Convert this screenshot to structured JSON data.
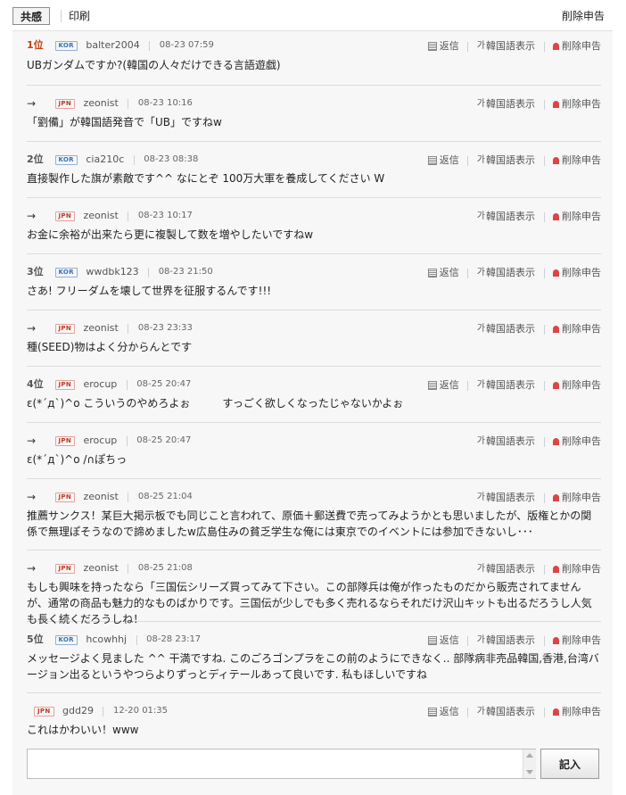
{
  "toolbar": {
    "empathy": "共感",
    "print": "印刷",
    "report": "削除申告"
  },
  "labels": {
    "reply": "返信",
    "korean": "韓国語表示",
    "korean_prefix": "가",
    "report": "削除申告",
    "arrow": "→"
  },
  "comments": [
    {
      "rank": "1位",
      "country": "KOR",
      "user": "balter2004",
      "date": "08-23 07:59",
      "text": "UBガンダムですか?(韓国の人々だけできる言語遊戯)"
    },
    {
      "rank": "",
      "country": "JPN",
      "user": "zeonist",
      "date": "08-23 10:16",
      "text": "「劉備」が韓国語発音で「UB」ですねw"
    },
    {
      "rank": "2位",
      "country": "KOR",
      "user": "cia210c",
      "date": "08-23 08:38",
      "text": "直接製作した旗が素敵です^^ なにとぞ 100万大軍を養成してください W"
    },
    {
      "rank": "",
      "country": "JPN",
      "user": "zeonist",
      "date": "08-23 10:17",
      "text": "お金に余裕が出来たら更に複製して数を増やしたいですねw"
    },
    {
      "rank": "3位",
      "country": "KOR",
      "user": "wwdbk123",
      "date": "08-23 21:50",
      "text": "さあ! フリーダムを壊して世界を征服するんです!!!"
    },
    {
      "rank": "",
      "country": "JPN",
      "user": "zeonist",
      "date": "08-23 23:33",
      "text": "種(SEED)物はよく分からんとです"
    },
    {
      "rank": "4位",
      "country": "JPN",
      "user": "erocup",
      "date": "08-25 20:47",
      "text": "ε(*´д`)^o こういうのやめろよぉ　　　すっごく欲しくなったじゃないかよぉ"
    },
    {
      "rank": "",
      "country": "JPN",
      "user": "erocup",
      "date": "08-25 20:47",
      "text": "ε(*´д`)^o /∩ぽちっ"
    },
    {
      "rank": "",
      "country": "JPN",
      "user": "zeonist",
      "date": "08-25 21:04",
      "text": "推薦サンクス！某巨大掲示板でも同じこと言われて、原価＋郵送費で売ってみようかとも思いましたが、版権とかの関係で無理ぽそうなので諦めましたw広島住みの貧乏学生な俺には東京でのイベントには参加できないし･･･"
    },
    {
      "rank": "",
      "country": "JPN",
      "user": "zeonist",
      "date": "08-25 21:08",
      "text": "もしも興味を持ったなら「三国伝シリーズ買ってみて下さい。この部隊兵は俺が作ったものだから販売されてませんが、通常の商品も魅力的なものばかりです。三国伝が少しでも多く売れるならそれだけ沢山キットも出るだろうし人気も長く続くだろうしね！"
    },
    {
      "rank": "5位",
      "country": "KOR",
      "user": "hcowhhj",
      "date": "08-28 23:17",
      "text": "メッセージよく見ました ^^ 干満ですね. このごろゴンプラをこの前のようにできなく.. 部隊病非売品韓国,香港,台湾バージョン出るというやつらよりずっとディテールあって良いです. 私もほしいですね"
    },
    {
      "rank": "",
      "country": "JPN",
      "user": "gdd29",
      "date": "12-20 01:35",
      "text": "これはかわいい！www"
    }
  ],
  "composer": {
    "submit": "記入"
  }
}
